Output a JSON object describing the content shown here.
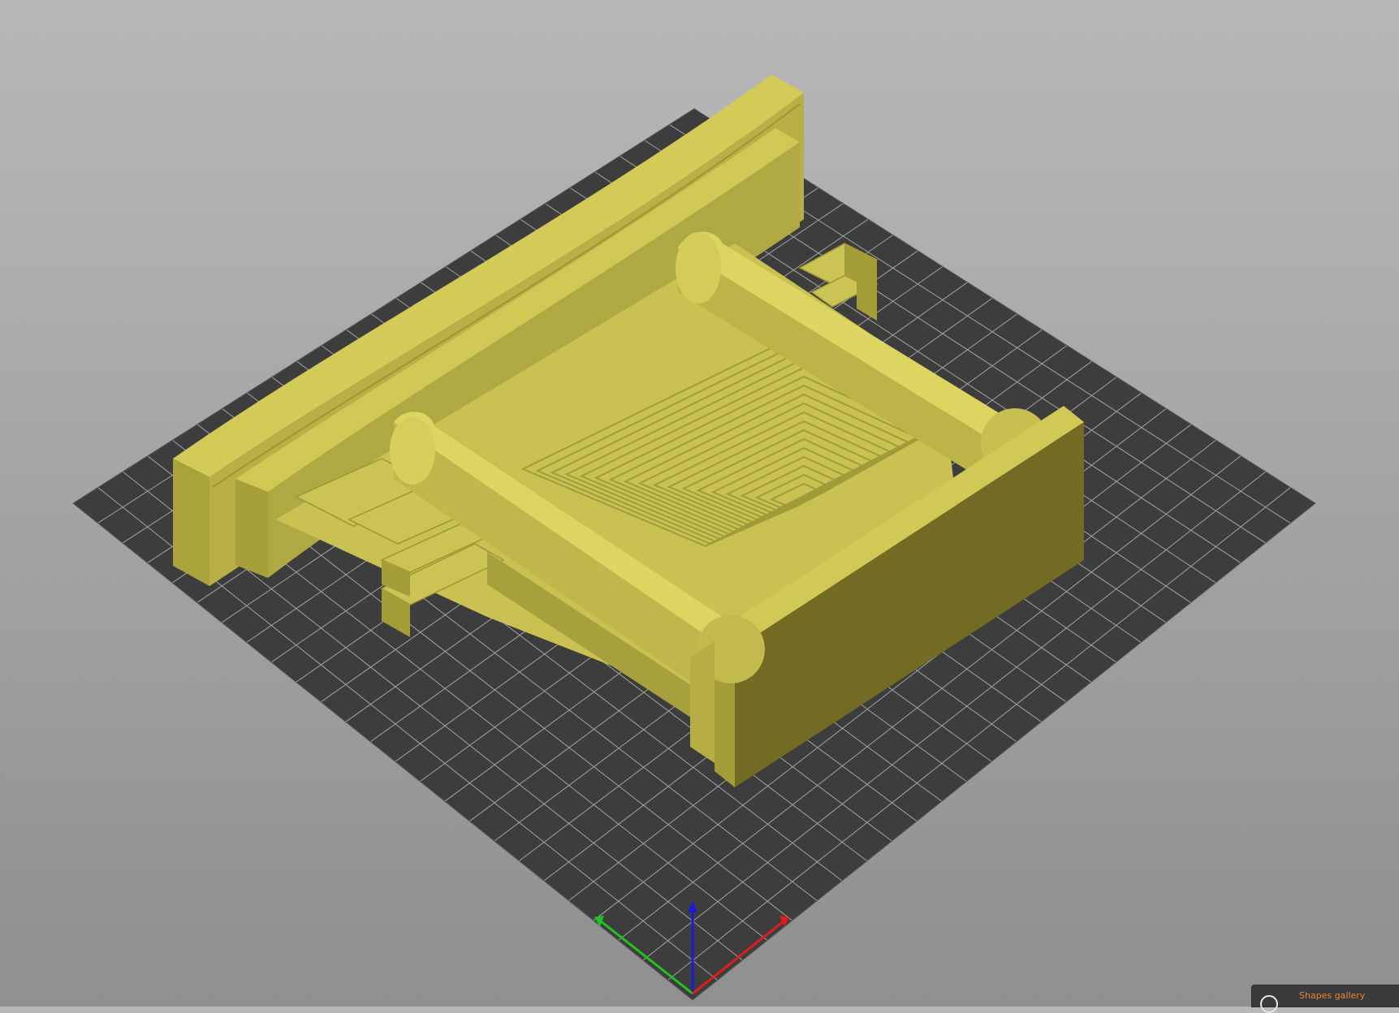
{
  "app": {
    "view": "3d-plater",
    "bed_color": "#3d3d3d",
    "bed_grid_color": "#c9c9c9",
    "model_color": "#c9c24f"
  },
  "axes": {
    "x_color": "#e31b1b",
    "y_color": "#1fc21f",
    "z_color": "#1b1bd6"
  },
  "gallery": {
    "label": "Shapes gallery",
    "icon": "shapes-gallery-icon"
  }
}
